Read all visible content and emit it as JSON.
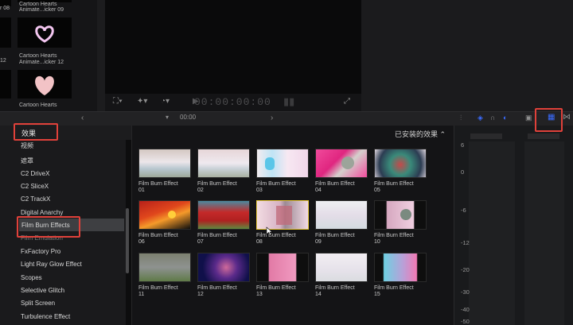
{
  "browser_clips": [
    {
      "side_label": "r 08",
      "line1": "Cartoon Hearts",
      "line2": "Animate...icker 09"
    },
    {
      "side_label": "12",
      "line1": "Cartoon Hearts",
      "line2": "Animate...icker 12"
    },
    {
      "side_label": "",
      "line1": "Cartoon Hearts",
      "line2": ""
    }
  ],
  "viewer": {
    "timecode": "00:00:00:00"
  },
  "timeline": {
    "time": "00:00"
  },
  "effects": {
    "header": "效果",
    "installed_label": "已安装的效果 ⌃",
    "categories": [
      "视频",
      "遮罩",
      "C2 DriveX",
      "C2 SliceX",
      "C2 TrackX",
      "Digital Anarchy",
      "Film Burn Effects",
      "Film Emulation",
      "FxFactory Pro",
      "Light Ray Glow Effect",
      "Scopes",
      "Selective Glitch",
      "Split Screen",
      "Turbulence Effect"
    ],
    "selected_category": "Film Burn Effects",
    "items": [
      {
        "name": "Film Burn Effect",
        "num": "01"
      },
      {
        "name": "Film Burn Effect",
        "num": "02"
      },
      {
        "name": "Film Burn Effect",
        "num": "03"
      },
      {
        "name": "Film Burn Effect",
        "num": "04"
      },
      {
        "name": "Film Burn Effect",
        "num": "05"
      },
      {
        "name": "Film Burn Effect",
        "num": "06"
      },
      {
        "name": "Film Burn Effect",
        "num": "07"
      },
      {
        "name": "Film Burn Effect",
        "num": "08"
      },
      {
        "name": "Film Burn Effect",
        "num": "09"
      },
      {
        "name": "Film Burn Effect",
        "num": "10"
      },
      {
        "name": "Film Burn Effect",
        "num": "11"
      },
      {
        "name": "Film Burn Effect",
        "num": "12"
      },
      {
        "name": "Film Burn Effect",
        "num": "13"
      },
      {
        "name": "Film Burn Effect",
        "num": "14"
      },
      {
        "name": "Film Burn Effect",
        "num": "15"
      }
    ]
  },
  "meter": {
    "labels": [
      "6",
      "0",
      "-6",
      "-12",
      "-20",
      "-30",
      "-40",
      "-50"
    ]
  },
  "colors": {
    "highlight": "#e0413a",
    "selection": "#e8c83a",
    "accent_blue": "#3b6cff"
  }
}
